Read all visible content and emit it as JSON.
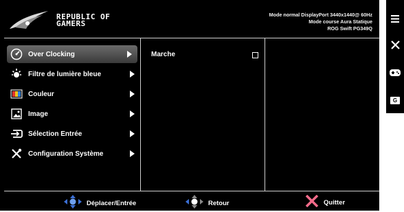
{
  "brand": {
    "line1": "REPUBLIC OF",
    "line2": "GAMERS"
  },
  "status": [
    "Mode normal DisplayPort 3440x1440@ 60Hz",
    "Mode course Aura Statique",
    "ROG Swift PG349Q"
  ],
  "menu": {
    "items": [
      {
        "label": "Over Clocking",
        "icon": "speedometer-icon",
        "selected": true
      },
      {
        "label": "Filtre de lumière bleue",
        "icon": "blue-light-icon"
      },
      {
        "label": "Couleur",
        "icon": "color-icon"
      },
      {
        "label": "Image",
        "icon": "image-icon"
      },
      {
        "label": "Sélection Entrée",
        "icon": "input-select-icon"
      },
      {
        "label": "Configuration Système",
        "icon": "system-config-icon"
      }
    ]
  },
  "submenu": {
    "options": [
      {
        "label": "Marche",
        "checked": false
      }
    ]
  },
  "footer": {
    "move_label": "Déplacer/Entrée",
    "back_label": "Retour",
    "exit_label": "Quitter"
  },
  "sidebar": {
    "icons": [
      "menu-icon",
      "close-icon",
      "gamepad-icon",
      "gameplus-icon"
    ],
    "g_label": "G"
  },
  "colors": {
    "background": "#000000",
    "accent_exit": "#f26b8a",
    "accent_nav": "#3b6fd6"
  }
}
